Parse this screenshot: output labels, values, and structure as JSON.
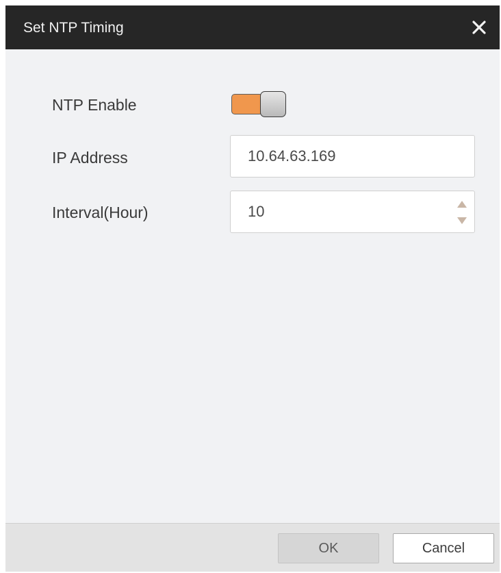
{
  "dialog": {
    "title": "Set NTP Timing",
    "close_icon": "close-icon"
  },
  "form": {
    "ntp_enable": {
      "label": "NTP Enable",
      "enabled": true,
      "track_color": "#f0974d"
    },
    "ip_address": {
      "label": "IP Address",
      "value": "10.64.63.169"
    },
    "interval": {
      "label": "Interval(Hour)",
      "value": "10",
      "up_icon": "spin-up-icon",
      "down_icon": "spin-down-icon"
    }
  },
  "footer": {
    "ok_label": "OK",
    "cancel_label": "Cancel"
  }
}
